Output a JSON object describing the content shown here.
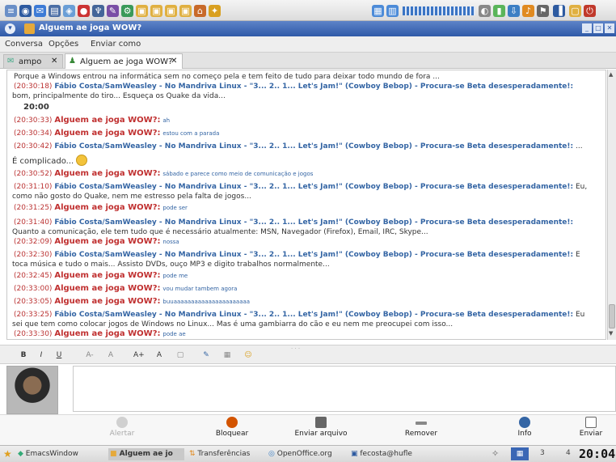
{
  "window": {
    "title": "Alguem ae joga WOW?",
    "controls": [
      "_",
      "□",
      "✕"
    ]
  },
  "menubar": {
    "items": [
      {
        "label": "Conversa",
        "accel": "C"
      },
      {
        "label": "Opções",
        "accel": "O"
      },
      {
        "label": "Enviar como",
        "accel": "E"
      }
    ]
  },
  "tabs": [
    {
      "label": "ampo",
      "active": false
    },
    {
      "label": "Alguem ae joga WOW?",
      "active": true
    }
  ],
  "chat": {
    "top_line": "Porque a Windows entrou na informática sem no começo pela e tem feito de tudo para deixar todo mundo de fora ...",
    "messages": [
      {
        "ts": "(20:30:18)",
        "sender": "Fábio Costa/SamWeasley - No Mandriva Linux - \"3... 2.. 1... Let's Jam!\" (Cowboy Bebop) - Procura-se Beta desesperadamente!:",
        "text": "",
        "kind": "other"
      },
      {
        "ts": "",
        "sender": "",
        "text": "bom, principalmente do tiro... Esqueça os Quake da vida...",
        "kind": "cont"
      },
      {
        "ts": "",
        "sender": "",
        "text": "20:00",
        "kind": "cont"
      },
      {
        "ts": "(20:30:33)",
        "sender": "Alguem ae joga WOW?:",
        "text": "ah",
        "kind": "me"
      },
      {
        "ts": "(20:30:34)",
        "sender": "Alguem ae joga WOW?:",
        "text": "estou com a parada",
        "kind": "me"
      },
      {
        "ts": "(20:30:42)",
        "sender": "Fábio Costa/SamWeasley - No Mandriva Linux - \"3... 2.. 1... Let's Jam!\" (Cowboy Bebop) - Procura-se Beta desesperadamente!:",
        "text": "...",
        "kind": "other"
      },
      {
        "ts": "",
        "sender": "",
        "text": "É complicado...",
        "kind": "cont"
      },
      {
        "ts": "(20:30:52)",
        "sender": "Alguem ae joga WOW?:",
        "text": "sábado e parece como meio de comunicação e jogos",
        "kind": "me"
      },
      {
        "ts": "(20:31:10)",
        "sender": "Fábio Costa/SamWeasley - No Mandriva Linux - \"3... 2.. 1... Let's Jam!\" (Cowboy Bebop) - Procura-se Beta desesperadamente!:",
        "text": "Eu,",
        "kind": "other"
      },
      {
        "ts": "",
        "sender": "",
        "text": "como não gosto do Quake, nem me estresso pela falta de jogos...",
        "kind": "cont"
      },
      {
        "ts": "(20:31:25)",
        "sender": "Alguem ae joga WOW?:",
        "text": "pode ser",
        "kind": "me"
      },
      {
        "ts": "(20:31:40)",
        "sender": "Fábio Costa/SamWeasley - No Mandriva Linux - \"3... 2.. 1... Let's Jam!\" (Cowboy Bebop) - Procura-se Beta desesperadamente!:",
        "text": "",
        "kind": "other"
      },
      {
        "ts": "",
        "sender": "",
        "text": "Quanto a comunicação, ele tem tudo que é necessário atualmente: MSN, Navegador (Firefox), Email, IRC, Skype...",
        "kind": "cont"
      },
      {
        "ts": "(20:32:09)",
        "sender": "Alguem ae joga WOW?:",
        "text": "nossa",
        "kind": "me"
      },
      {
        "ts": "(20:32:30)",
        "sender": "Fábio Costa/SamWeasley - No Mandriva Linux - \"3... 2.. 1... Let's Jam!\" (Cowboy Bebop) - Procura-se Beta desesperadamente!:",
        "text": "E",
        "kind": "other"
      },
      {
        "ts": "",
        "sender": "",
        "text": "toca música e tudo o mais... Assisto DVDs, ouço MP3 e digito trabalhos normalmente...",
        "kind": "cont"
      },
      {
        "ts": "(20:32:45)",
        "sender": "Alguem ae joga WOW?:",
        "text": "pode me",
        "kind": "me"
      },
      {
        "ts": "(20:33:00)",
        "sender": "Alguem ae joga WOW?:",
        "text": "vou mudar tambem agora",
        "kind": "me"
      },
      {
        "ts": "(20:33:05)",
        "sender": "Alguem ae joga WOW?:",
        "text": "buuaaaaaaaaaaaaaaaaaaaaaa",
        "kind": "me"
      },
      {
        "ts": "(20:33:25)",
        "sender": "Fábio Costa/SamWeasley - No Mandriva Linux - \"3... 2.. 1... Let's Jam!\" (Cowboy Bebop) - Procura-se Beta desesperadamente!:",
        "text": "Eu",
        "kind": "other"
      },
      {
        "ts": "",
        "sender": "",
        "text": "sei que tem como colocar jogos de Windows no Linux... Mas é uma gambiarra do cão e eu nem me preocupei com isso...",
        "kind": "cont"
      },
      {
        "ts": "(20:33:30)",
        "sender": "Alguem ae joga WOW?:",
        "text": "pode ae",
        "kind": "me"
      }
    ]
  },
  "format_toolbar": {
    "buttons": [
      "B",
      "I",
      "U",
      "A-",
      "A",
      "A+",
      "A",
      "▢",
      "✎",
      "▦",
      "☺"
    ]
  },
  "actions": [
    {
      "label": "Alertar",
      "icon": "alert-icon",
      "color": "#b0b0b0",
      "enabled": false
    },
    {
      "label": "Bloquear",
      "icon": "block-icon",
      "color": "#d35400",
      "enabled": true
    },
    {
      "label": "Enviar arquivo",
      "icon": "send-file-icon",
      "color": "#555555",
      "enabled": true
    },
    {
      "label": "Remover",
      "icon": "remove-icon",
      "color": "#777777",
      "enabled": true
    },
    {
      "label": "Info",
      "icon": "info-icon",
      "color": "#3465a4",
      "enabled": true
    },
    {
      "label": "Enviar",
      "icon": "send-icon",
      "color": "#666666",
      "enabled": true
    }
  ],
  "taskbar": {
    "items": [
      {
        "label": "EmacsWindow",
        "active": false
      },
      {
        "label": "Alguem ae jo",
        "active": true
      },
      {
        "label": "Transferências",
        "active": false
      },
      {
        "label": "OpenOffice.org",
        "active": false
      },
      {
        "label": "fecosta@hufle",
        "active": false
      }
    ],
    "clock": "20:04",
    "workspaces": [
      "3",
      "4"
    ]
  },
  "colors": {
    "titlebar": "#3b67b5",
    "own_name": "#c03030",
    "other_name": "#3465a4",
    "timestamp": "#b33333"
  }
}
